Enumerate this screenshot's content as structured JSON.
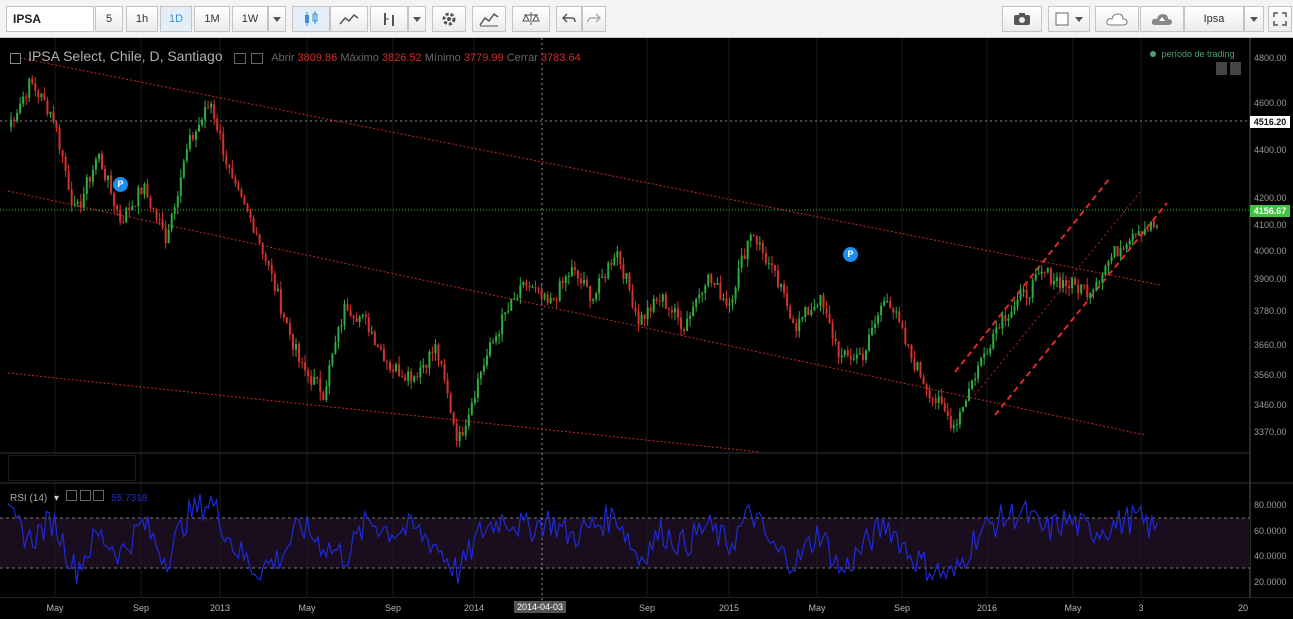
{
  "toolbar": {
    "symbol": "IPSA",
    "intervals": [
      "5",
      "1h",
      "1D",
      "1M",
      "1W"
    ],
    "active_interval": "1D",
    "right_symbol": "Ipsa"
  },
  "legend": {
    "title": "IPSA Select, Chile, D, Santiago",
    "open_label": "Abrir",
    "open_value": "3809.86",
    "high_label": "Máximo",
    "high_value": "3826.52",
    "low_label": "Mínimo",
    "low_value": "3779.99",
    "close_label": "Cerrar",
    "close_value": "3783.64"
  },
  "trading_period": "período de trading",
  "rsi": {
    "label": "RSI (14)",
    "value": "55.7318"
  },
  "price_axis": {
    "ticks": [
      "4800.00",
      "4600.00",
      "4400.00",
      "4200.00",
      "4100.00",
      "4000.00",
      "3900.00",
      "3780.00",
      "3660.00",
      "3560.00",
      "3460.00",
      "3370.00"
    ],
    "badge_upper": "4516.20",
    "badge_current": "4156.67"
  },
  "rsi_axis": {
    "ticks": [
      "80.0000",
      "60.0000",
      "40.0000",
      "20.0000"
    ]
  },
  "time_axis": {
    "labels": [
      "May",
      "Sep",
      "2013",
      "May",
      "Sep",
      "2014",
      "2014-04-03",
      "Sep",
      "2015",
      "May",
      "Sep",
      "2016",
      "May",
      "3",
      "20"
    ],
    "highlight": "2014-04-03"
  },
  "colors": {
    "up_candle": "#2fae3d",
    "down_candle": "#d2332b",
    "trend_line": "#d63030",
    "rsi_line": "#1f2ad8",
    "current_badge": "#3ec43e"
  },
  "chart_data": {
    "type": "candlestick",
    "series": [
      {
        "name": "IPSA Select, Chile, D, Santiago",
        "values": [
          4520,
          4680,
          4560,
          4200,
          4420,
          4180,
          4300,
          4120,
          4450,
          4610,
          4300,
          4150,
          3900,
          3650,
          3560,
          3880,
          3800,
          3650,
          3620,
          3720,
          3380,
          3640,
          3830,
          3950,
          3870,
          4000,
          3900,
          4080,
          3820,
          3900,
          3800,
          3980,
          3880,
          4150,
          3980,
          3800,
          3900,
          3680,
          3700,
          3920,
          3700,
          3550,
          3440,
          3640,
          3820,
          3900,
          3990,
          3950,
          3930,
          4050,
          4150,
          4160
        ]
      },
      {
        "name": "RSI (14)",
        "values": [
          68,
          52,
          66,
          30,
          56,
          42,
          64,
          38,
          70,
          80,
          48,
          30,
          38,
          62,
          48,
          40,
          66,
          58,
          60,
          48,
          28,
          58,
          68,
          60,
          66,
          54,
          62,
          70,
          38,
          58,
          48,
          62,
          48,
          72,
          44,
          36,
          58,
          28,
          48,
          64,
          42,
          30,
          26,
          56,
          66,
          72,
          58,
          66,
          58,
          62,
          68,
          58
        ]
      }
    ],
    "ylim": [
      3340,
      4840
    ],
    "rsi_ylim": [
      10,
      92
    ]
  }
}
